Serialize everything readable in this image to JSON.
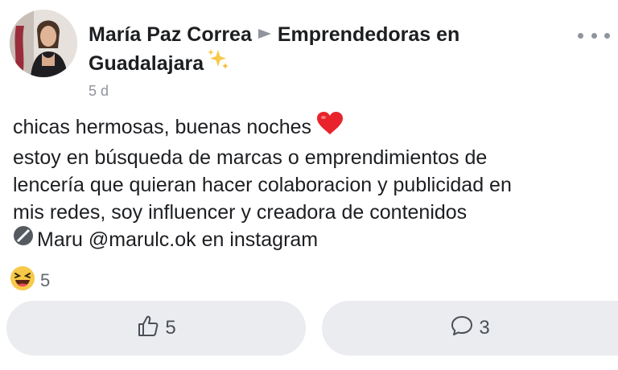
{
  "post": {
    "author": "María Paz Correa",
    "group": "Emprendedoras en",
    "group_cont": "Guadalajara",
    "timestamp": "5 d",
    "lines": [
      "chicas hermosas, buenas noches",
      "estoy en búsqueda de marcas o emprendimientos de",
      "lencería que quieran hacer colaboracion y publicidad en",
      "mis redes, soy influencer y creadora de contenidos"
    ],
    "mention_name": "Maru",
    "mention_rest": " @marulc.ok en instagram"
  },
  "reactions": {
    "count": "5",
    "icon": "laughing-emoji"
  },
  "actions": {
    "like_count": "5",
    "comment_count": "3"
  },
  "icons": {
    "arrow": "right-triangle-arrow",
    "sparkle": "sparkles",
    "heart": "red-heart",
    "blocked": "no-entry-sign",
    "more": "ellipsis",
    "like": "thumbs-up",
    "comment": "speech-bubble"
  },
  "colors": {
    "text": "#1c1e21",
    "secondary": "#90949c",
    "button_bg": "#eaecef",
    "heart": "#e8232b"
  }
}
